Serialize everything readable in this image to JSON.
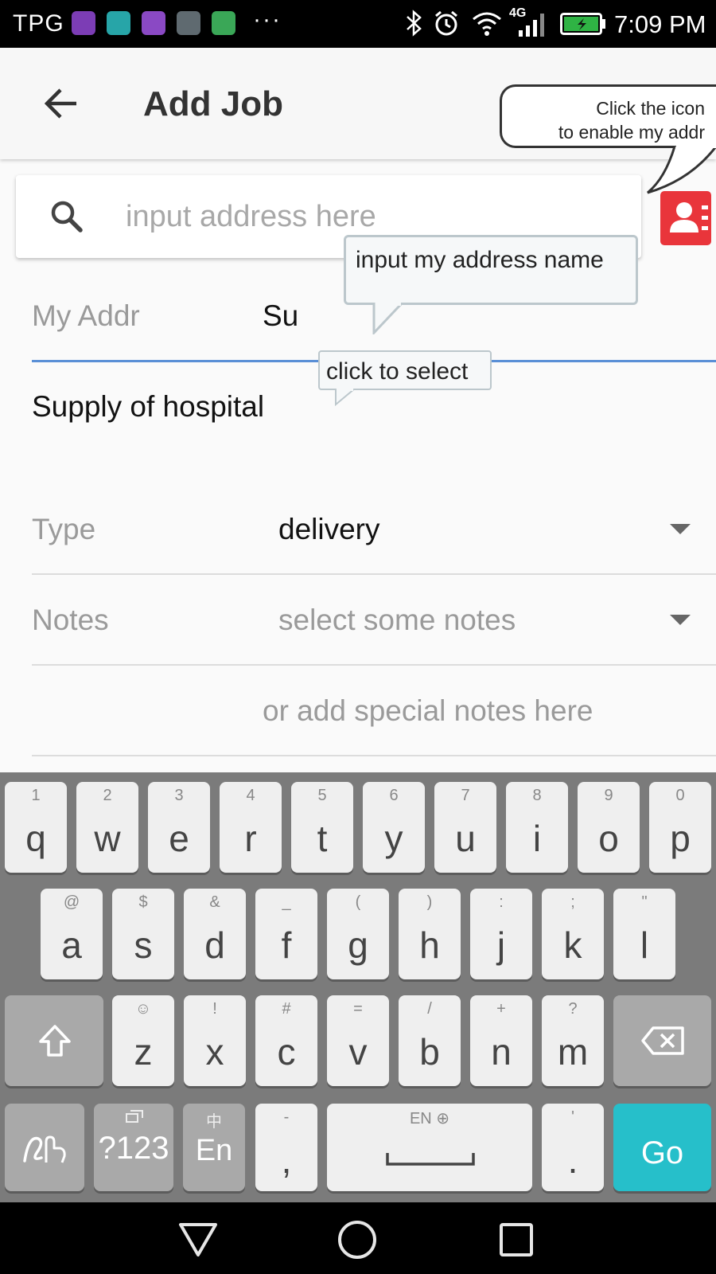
{
  "status_bar": {
    "carrier": "TPG",
    "network": "4G",
    "time": "7:09 PM",
    "more": "···",
    "battery_level": 1.0
  },
  "app_bar": {
    "title": "Add Job"
  },
  "tooltips": {
    "icon_hint_line1": "Click the icon",
    "icon_hint_line2": "to enable my addr",
    "address_name_hint": "input my address name",
    "select_hint": "click to select"
  },
  "search": {
    "placeholder": "input address here",
    "value": ""
  },
  "form": {
    "my_addr_label": "My Addr",
    "my_addr_value": "Su",
    "suggestion": "Supply of hospital",
    "type_label": "Type",
    "type_value": "delivery",
    "notes_label": "Notes",
    "notes_placeholder": "select some notes",
    "special_notes_placeholder": "or add special notes here"
  },
  "keyboard": {
    "row1": [
      {
        "key": "q",
        "hint": "1"
      },
      {
        "key": "w",
        "hint": "2"
      },
      {
        "key": "e",
        "hint": "3"
      },
      {
        "key": "r",
        "hint": "4"
      },
      {
        "key": "t",
        "hint": "5"
      },
      {
        "key": "y",
        "hint": "6"
      },
      {
        "key": "u",
        "hint": "7"
      },
      {
        "key": "i",
        "hint": "8"
      },
      {
        "key": "o",
        "hint": "9"
      },
      {
        "key": "p",
        "hint": "0"
      }
    ],
    "row2": [
      {
        "key": "a",
        "hint": "@"
      },
      {
        "key": "s",
        "hint": "$"
      },
      {
        "key": "d",
        "hint": "&"
      },
      {
        "key": "f",
        "hint": "_"
      },
      {
        "key": "g",
        "hint": "("
      },
      {
        "key": "h",
        "hint": ")"
      },
      {
        "key": "j",
        "hint": ":"
      },
      {
        "key": "k",
        "hint": ";"
      },
      {
        "key": "l",
        "hint": "\""
      }
    ],
    "row3": [
      {
        "key": "z",
        "hint": "☺"
      },
      {
        "key": "x",
        "hint": "!"
      },
      {
        "key": "c",
        "hint": "#"
      },
      {
        "key": "v",
        "hint": "="
      },
      {
        "key": "b",
        "hint": "/"
      },
      {
        "key": "n",
        "hint": "+"
      },
      {
        "key": "m",
        "hint": "?"
      }
    ],
    "symbols_label": "?123",
    "lang_label": "En",
    "lang_hint": "中",
    "comma_label": ",",
    "comma_hint": "-",
    "space_hint": "EN ⊕",
    "period_label": ".",
    "period_hint": "'",
    "go_label": "Go"
  },
  "colors": {
    "accent_blue": "#5a8fd6",
    "address_book_red": "#e9353b",
    "go_key_teal": "#26bfca"
  }
}
